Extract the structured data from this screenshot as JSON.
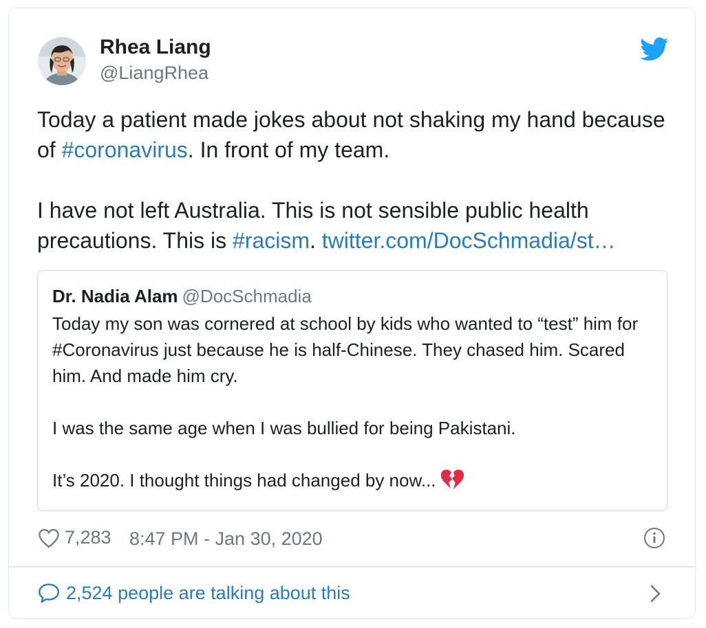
{
  "author": {
    "name": "Rhea Liang",
    "handle": "@LiangRhea",
    "avatar_icon": "avatar-photo"
  },
  "brand": {
    "icon": "twitter-bird-icon",
    "color": "#1da1f2"
  },
  "tweet": {
    "p1_a": "Today a patient made jokes about not shaking my hand because of ",
    "p1_hashtag": "#coronavirus",
    "p1_b": ". In front of my team.",
    "p2_a": "I have not left Australia. This is not sensible public health precautions. This is ",
    "p2_hashtag": "#racism",
    "p2_b": ". ",
    "p2_link": "twitter.com/DocSchmadia/st…"
  },
  "quote": {
    "name": "Dr. Nadia Alam",
    "handle": "@DocSchmadia",
    "p1": "Today my son was cornered at school by kids who wanted to “test” him for #Coronavirus just because he is half-Chinese. They chased him. Scared him. And made him cry.",
    "p2": "I was the same age when I was bullied for being Pakistani.",
    "p3": "It’s 2020. I thought things had changed by now...",
    "emoji_icon": "broken-heart-icon"
  },
  "footer": {
    "likes": "7,283",
    "timestamp": "8:47 PM - Jan 30, 2020"
  },
  "conversation": {
    "label": "2,524 people are talking about this"
  },
  "colors": {
    "link": "#2b7bb9",
    "text": "#1c2022",
    "muted": "#697882",
    "border": "#e1e8ed"
  }
}
